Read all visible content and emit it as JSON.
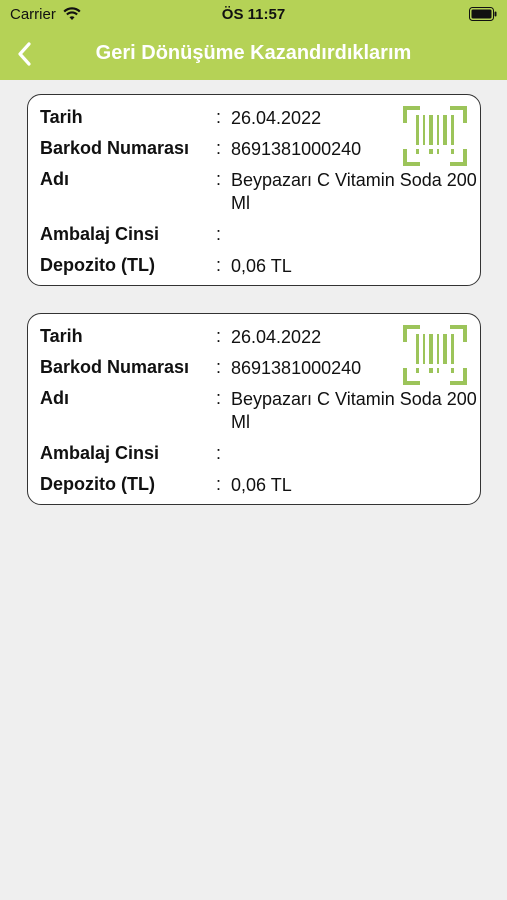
{
  "status_bar": {
    "carrier": "Carrier",
    "time": "ÖS 11:57"
  },
  "nav": {
    "title": "Geri Dönüşüme Kazandırdıklarım"
  },
  "labels": {
    "date": "Tarih",
    "barcode": "Barkod Numarası",
    "name": "Adı",
    "package": "Ambalaj Cinsi",
    "deposit": "Depozito (TL)",
    "colon": ":"
  },
  "records": [
    {
      "date": "26.04.2022",
      "barcode": "8691381000240",
      "name": "Beypazarı C Vitamin Soda 200 Ml",
      "package": "",
      "deposit": "0,06 TL"
    },
    {
      "date": "26.04.2022",
      "barcode": "8691381000240",
      "name": "Beypazarı C Vitamin Soda 200 Ml",
      "package": "",
      "deposit": "0,06 TL"
    }
  ],
  "colors": {
    "brand": "#b5d256",
    "icon": "#9cc45a",
    "background": "#efefef"
  },
  "icons": {
    "back": "chevron-left-icon",
    "barcode": "barcode-scan-icon",
    "wifi": "wifi-icon",
    "battery": "battery-icon"
  }
}
